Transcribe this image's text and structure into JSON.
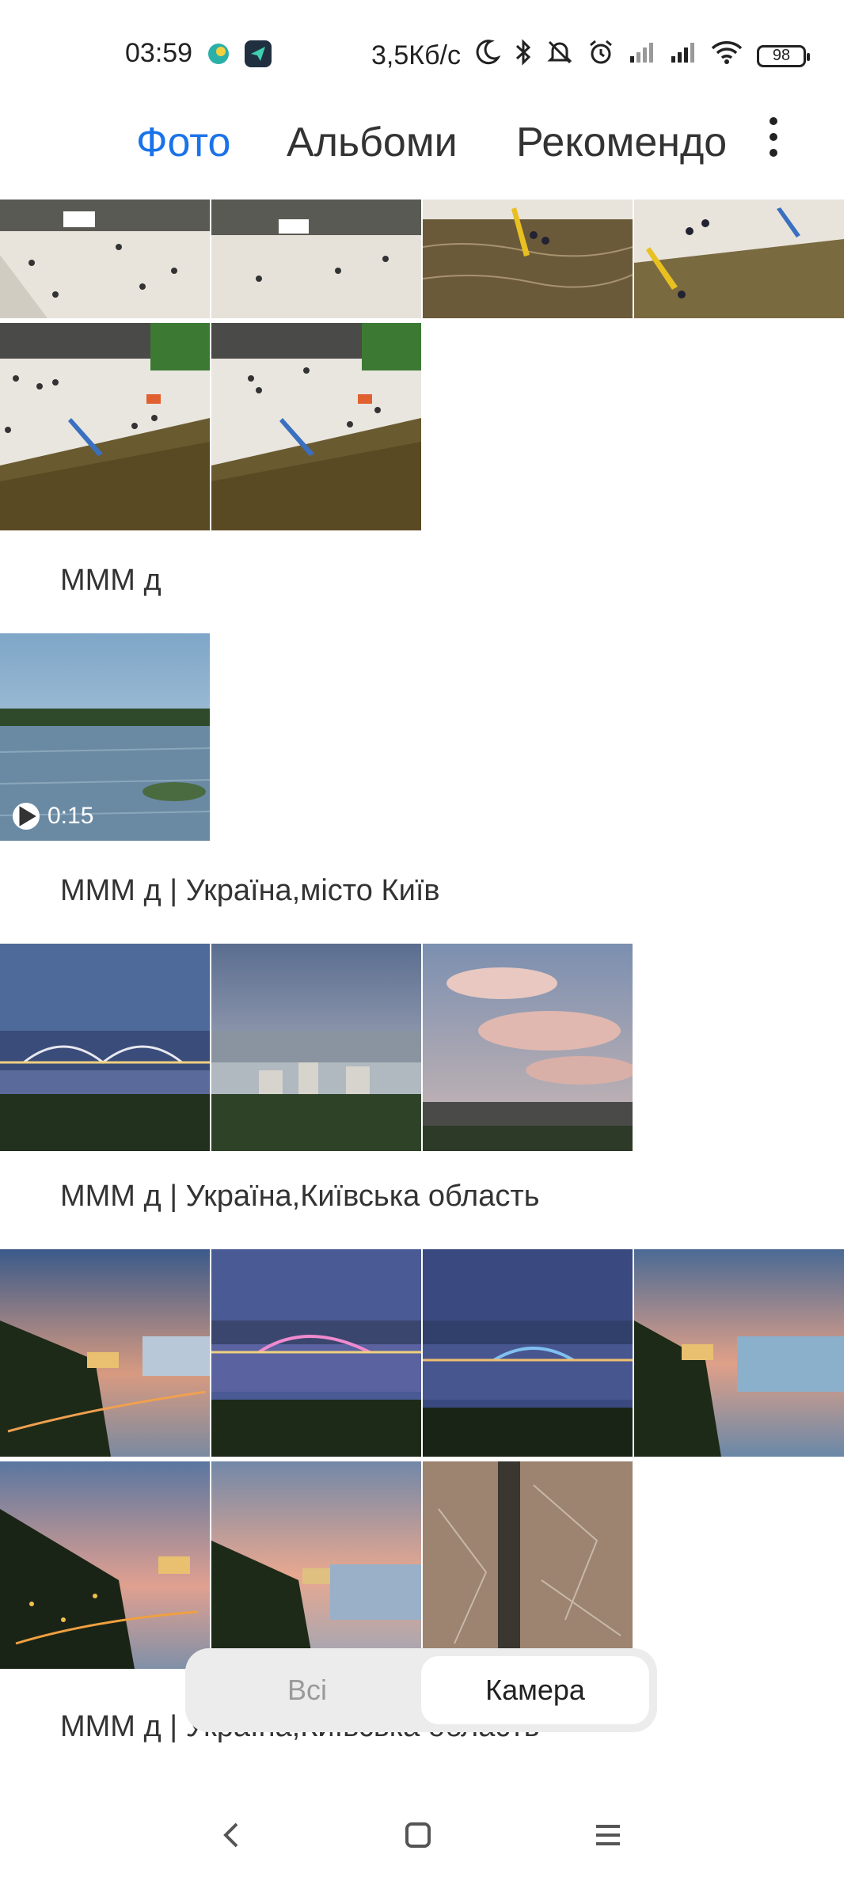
{
  "status_bar": {
    "time": "03:59",
    "network_speed": "3,5Кб/с",
    "battery_level": "98",
    "icons": [
      "app-notification-icon",
      "telegram-icon",
      "moon-icon",
      "bluetooth-icon",
      "mute-icon",
      "alarm-icon",
      "signal-icon",
      "signal-icon",
      "wifi-icon"
    ]
  },
  "tabs": [
    {
      "label": "Фото",
      "active": true
    },
    {
      "label": "Альбоми",
      "active": false
    },
    {
      "label": "Рекомендо",
      "active": false
    }
  ],
  "sections": [
    {
      "header": "МММ д",
      "video_duration": "0:15"
    },
    {
      "header": "МММ д | Україна,місто Київ"
    },
    {
      "header": "МММ д | Україна,Київська область"
    },
    {
      "header": "МММ д | Україна,Київська область"
    }
  ],
  "filter": {
    "options": [
      {
        "label": "Всі",
        "active": false
      },
      {
        "label": "Камера",
        "active": true
      }
    ]
  },
  "accent_color": "#1a73e8"
}
